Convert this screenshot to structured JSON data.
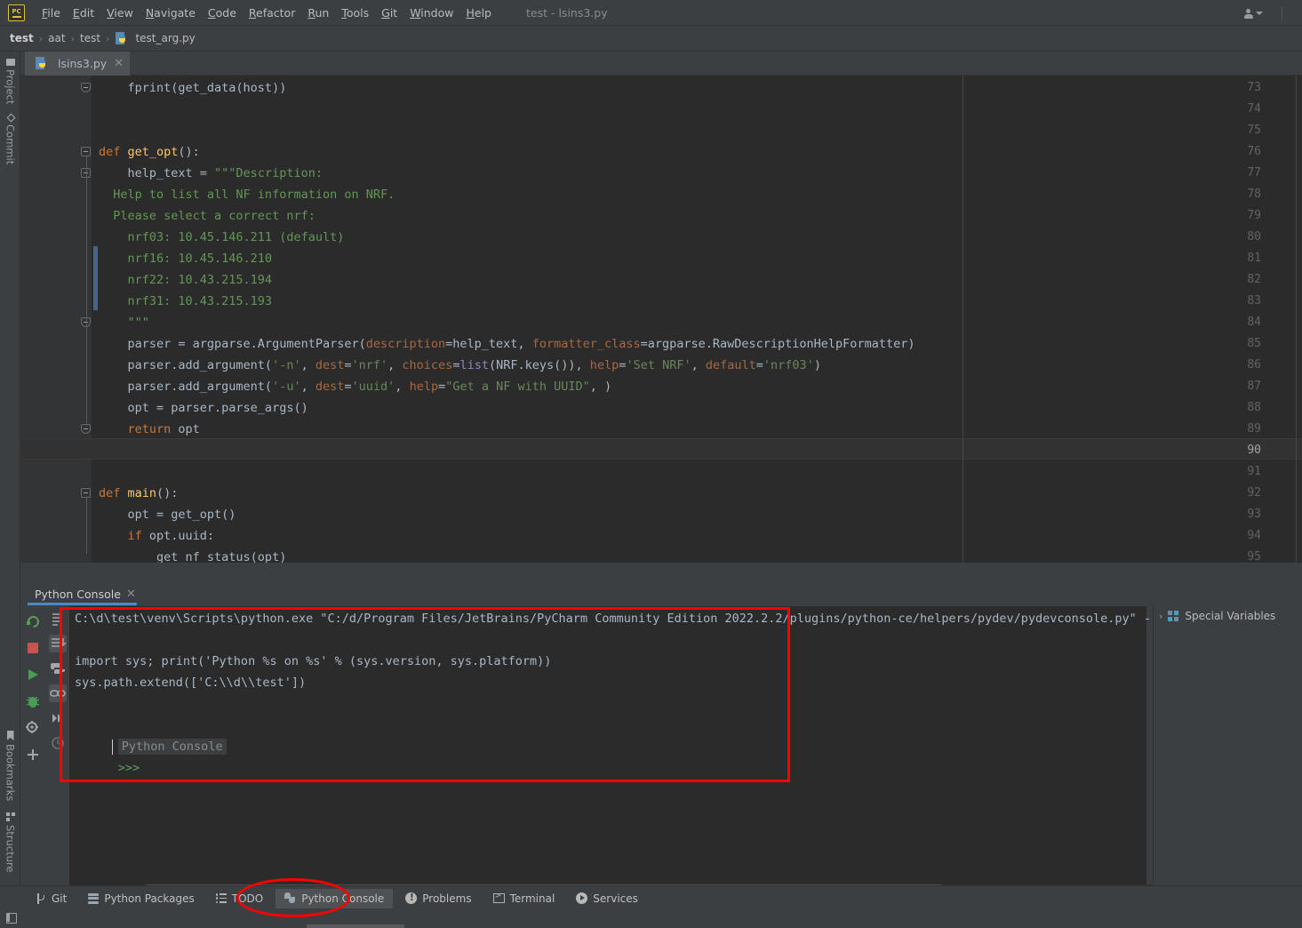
{
  "menu": {
    "logo": "pycharm-logo",
    "items": [
      "File",
      "Edit",
      "View",
      "Navigate",
      "Code",
      "Refactor",
      "Run",
      "Tools",
      "Git",
      "Window",
      "Help"
    ],
    "window_title": "test - lsins3.py",
    "account_icon": "account-icon"
  },
  "breadcrumb": {
    "items": [
      "test",
      "aat",
      "test",
      "test_arg.py"
    ]
  },
  "left_strip": {
    "top_items": [
      "Project",
      "Commit"
    ],
    "bottom_items": [
      "Bookmarks",
      "Structure"
    ]
  },
  "editor_tabs": [
    {
      "label": "lsins3.py",
      "close": "✕"
    }
  ],
  "editor": {
    "current_line": 90,
    "first_visible_line": 73,
    "lines": [
      {
        "n": 73,
        "tokens": [
          {
            "t": "    fprint(get_data(host))",
            "c": "plain"
          }
        ]
      },
      {
        "n": 74,
        "tokens": []
      },
      {
        "n": 75,
        "tokens": []
      },
      {
        "n": 76,
        "tokens": [
          {
            "t": "def ",
            "c": "kw"
          },
          {
            "t": "get_opt",
            "c": "fn"
          },
          {
            "t": "():",
            "c": "plain"
          }
        ]
      },
      {
        "n": 77,
        "tokens": [
          {
            "t": "    help_text = ",
            "c": "plain"
          },
          {
            "t": "\"\"\"Description:",
            "c": "doc"
          }
        ]
      },
      {
        "n": 78,
        "tokens": [
          {
            "t": "  Help to list all NF information on NRF.",
            "c": "doc"
          }
        ]
      },
      {
        "n": 79,
        "tokens": [
          {
            "t": "  Please select a correct nrf:",
            "c": "doc"
          }
        ]
      },
      {
        "n": 80,
        "tokens": [
          {
            "t": "    nrf03: 10.45.146.211 (default)",
            "c": "doc"
          }
        ]
      },
      {
        "n": 81,
        "tokens": [
          {
            "t": "    nrf16: 10.45.146.210",
            "c": "doc"
          }
        ]
      },
      {
        "n": 82,
        "tokens": [
          {
            "t": "    nrf22: 10.43.215.194",
            "c": "doc"
          }
        ]
      },
      {
        "n": 83,
        "tokens": [
          {
            "t": "    nrf31: 10.43.215.193",
            "c": "doc"
          }
        ]
      },
      {
        "n": 84,
        "tokens": [
          {
            "t": "    \"\"\"",
            "c": "doc"
          }
        ]
      },
      {
        "n": 85,
        "tokens": [
          {
            "t": "    parser = argparse.ArgumentParser(",
            "c": "plain"
          },
          {
            "t": "description",
            "c": "param"
          },
          {
            "t": "=help_text, ",
            "c": "plain"
          },
          {
            "t": "formatter_class",
            "c": "param"
          },
          {
            "t": "=argparse.RawDescriptionHelpFormatter)",
            "c": "plain"
          }
        ]
      },
      {
        "n": 86,
        "tokens": [
          {
            "t": "    parser.add_argument(",
            "c": "plain"
          },
          {
            "t": "'-n'",
            "c": "str"
          },
          {
            "t": ", ",
            "c": "plain"
          },
          {
            "t": "dest",
            "c": "param"
          },
          {
            "t": "=",
            "c": "plain"
          },
          {
            "t": "'nrf'",
            "c": "str"
          },
          {
            "t": ", ",
            "c": "plain"
          },
          {
            "t": "choices",
            "c": "param"
          },
          {
            "t": "=",
            "c": "plain"
          },
          {
            "t": "list",
            "c": "builtin"
          },
          {
            "t": "(NRF.keys()), ",
            "c": "plain"
          },
          {
            "t": "help",
            "c": "param"
          },
          {
            "t": "=",
            "c": "plain"
          },
          {
            "t": "'Set NRF'",
            "c": "str"
          },
          {
            "t": ", ",
            "c": "plain"
          },
          {
            "t": "default",
            "c": "param"
          },
          {
            "t": "=",
            "c": "plain"
          },
          {
            "t": "'nrf03'",
            "c": "str"
          },
          {
            "t": ")",
            "c": "plain"
          }
        ]
      },
      {
        "n": 87,
        "tokens": [
          {
            "t": "    parser.add_argument(",
            "c": "plain"
          },
          {
            "t": "'-u'",
            "c": "str"
          },
          {
            "t": ", ",
            "c": "plain"
          },
          {
            "t": "dest",
            "c": "param"
          },
          {
            "t": "=",
            "c": "plain"
          },
          {
            "t": "'uuid'",
            "c": "str"
          },
          {
            "t": ", ",
            "c": "plain"
          },
          {
            "t": "help",
            "c": "param"
          },
          {
            "t": "=",
            "c": "plain"
          },
          {
            "t": "\"Get a NF with UUID\"",
            "c": "str"
          },
          {
            "t": ", )",
            "c": "plain"
          }
        ]
      },
      {
        "n": 88,
        "tokens": [
          {
            "t": "    opt = parser.parse_args()",
            "c": "plain"
          }
        ]
      },
      {
        "n": 89,
        "tokens": [
          {
            "t": "    ",
            "c": "plain"
          },
          {
            "t": "return ",
            "c": "kw"
          },
          {
            "t": "opt",
            "c": "plain"
          }
        ]
      },
      {
        "n": 90,
        "tokens": []
      },
      {
        "n": 91,
        "tokens": []
      },
      {
        "n": 92,
        "tokens": [
          {
            "t": "def ",
            "c": "kw"
          },
          {
            "t": "main",
            "c": "fn"
          },
          {
            "t": "():",
            "c": "plain"
          }
        ]
      },
      {
        "n": 93,
        "tokens": [
          {
            "t": "    opt = get_opt()",
            "c": "plain"
          }
        ]
      },
      {
        "n": 94,
        "tokens": [
          {
            "t": "    ",
            "c": "plain"
          },
          {
            "t": "if ",
            "c": "kw"
          },
          {
            "t": "opt.uuid:",
            "c": "plain"
          }
        ]
      },
      {
        "n": 95,
        "tokens": [
          {
            "t": "        get_nf_status(opt)",
            "c": "plain"
          }
        ]
      }
    ]
  },
  "console": {
    "tab_label": "Python Console",
    "tab_close": "✕",
    "toolbar_left": [
      "rerun-icon",
      "stop-icon",
      "run-icon",
      "debug-icon",
      "settings-icon",
      "add-icon"
    ],
    "toolbar_right": [
      "soft-wrap-icon",
      "scroll-to-end-icon",
      "python-console-icon",
      "link-icon",
      "execute-icon",
      "history-icon"
    ],
    "lines": [
      "C:\\d\\test\\venv\\Scripts\\python.exe \"C:/d/Program Files/JetBrains/PyCharm Community Edition 2022.2.2/plugins/python-ce/helpers/pydev/pydevconsole.py\" --m",
      "",
      "import sys; print('Python %s on %s' % (sys.version, sys.platform))",
      "sys.path.extend(['C:\\\\d\\\\test'])"
    ],
    "banner_label": "Python Console",
    "prompt": ">>>"
  },
  "special_variables": {
    "chevron": "›",
    "label": "Special Variables"
  },
  "statusbar": {
    "items": [
      {
        "label": "Git",
        "icon": "git-icon",
        "active": false
      },
      {
        "label": "Python Packages",
        "icon": "packages-icon",
        "active": false
      },
      {
        "label": "TODO",
        "icon": "todo-icon",
        "active": false
      },
      {
        "label": "Python Console",
        "icon": "python-console-icon",
        "active": true
      },
      {
        "label": "Problems",
        "icon": "problems-icon",
        "active": false
      },
      {
        "label": "Terminal",
        "icon": "terminal-icon",
        "active": false
      },
      {
        "label": "Services",
        "icon": "services-icon",
        "active": false
      }
    ]
  },
  "annotations": {
    "rectangle_color": "#ff0000",
    "ellipse_color": "#ff0000"
  },
  "colors": {
    "bg_chrome": "#3c3f41",
    "bg_editor": "#2b2b2b",
    "gutter": "#313335",
    "accent_blue": "#4a88c7",
    "keyword": "#cc7832",
    "string": "#6a8759",
    "docstring": "#629755",
    "param": "#a9683f",
    "function": "#ffc66d",
    "text": "#a9b7c6"
  }
}
